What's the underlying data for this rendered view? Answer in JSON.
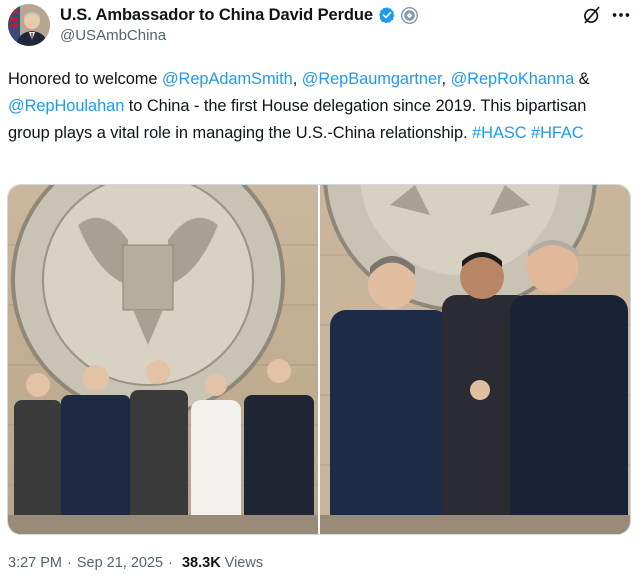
{
  "author": {
    "display_name": "U.S. Ambassador to China David Perdue",
    "handle": "@USAmbChina",
    "avatar": "ambassador-portrait",
    "verified_color": "#1d9bf0",
    "gov_badge_color": "#829aab"
  },
  "tweet": {
    "segments": [
      {
        "text": "Honored to welcome ",
        "type": "text"
      },
      {
        "text": "@RepAdamSmith",
        "type": "mention"
      },
      {
        "text": ", ",
        "type": "text"
      },
      {
        "text": "@RepBaumgartner",
        "type": "mention"
      },
      {
        "text": ", ",
        "type": "text"
      },
      {
        "text": "@RepRoKhanna",
        "type": "mention"
      },
      {
        "text": " & ",
        "type": "text"
      },
      {
        "text": "@RepHoulahan",
        "type": "mention"
      },
      {
        "text": " to China - the first House delegation since 2019. This bipartisan group plays a vital role in managing the U.S.-China relationship. ",
        "type": "text"
      },
      {
        "text": "#HASC",
        "type": "hashtag"
      },
      {
        "text": " ",
        "type": "text"
      },
      {
        "text": "#HFAC",
        "type": "hashtag"
      }
    ],
    "link_color": "#1d9bf0"
  },
  "media": {
    "photos": [
      {
        "name": "delegation-group-photo"
      },
      {
        "name": "handshake-greeting-photo"
      }
    ]
  },
  "meta": {
    "time": "3:27 PM",
    "separator": "·",
    "date": "Sep 21, 2025",
    "views_count": "38.3K",
    "views_label": "Views"
  },
  "icons": {
    "grok": "grok-icon",
    "more": "more-icon",
    "verified": "verified-badge-icon",
    "government": "government-badge-icon"
  }
}
